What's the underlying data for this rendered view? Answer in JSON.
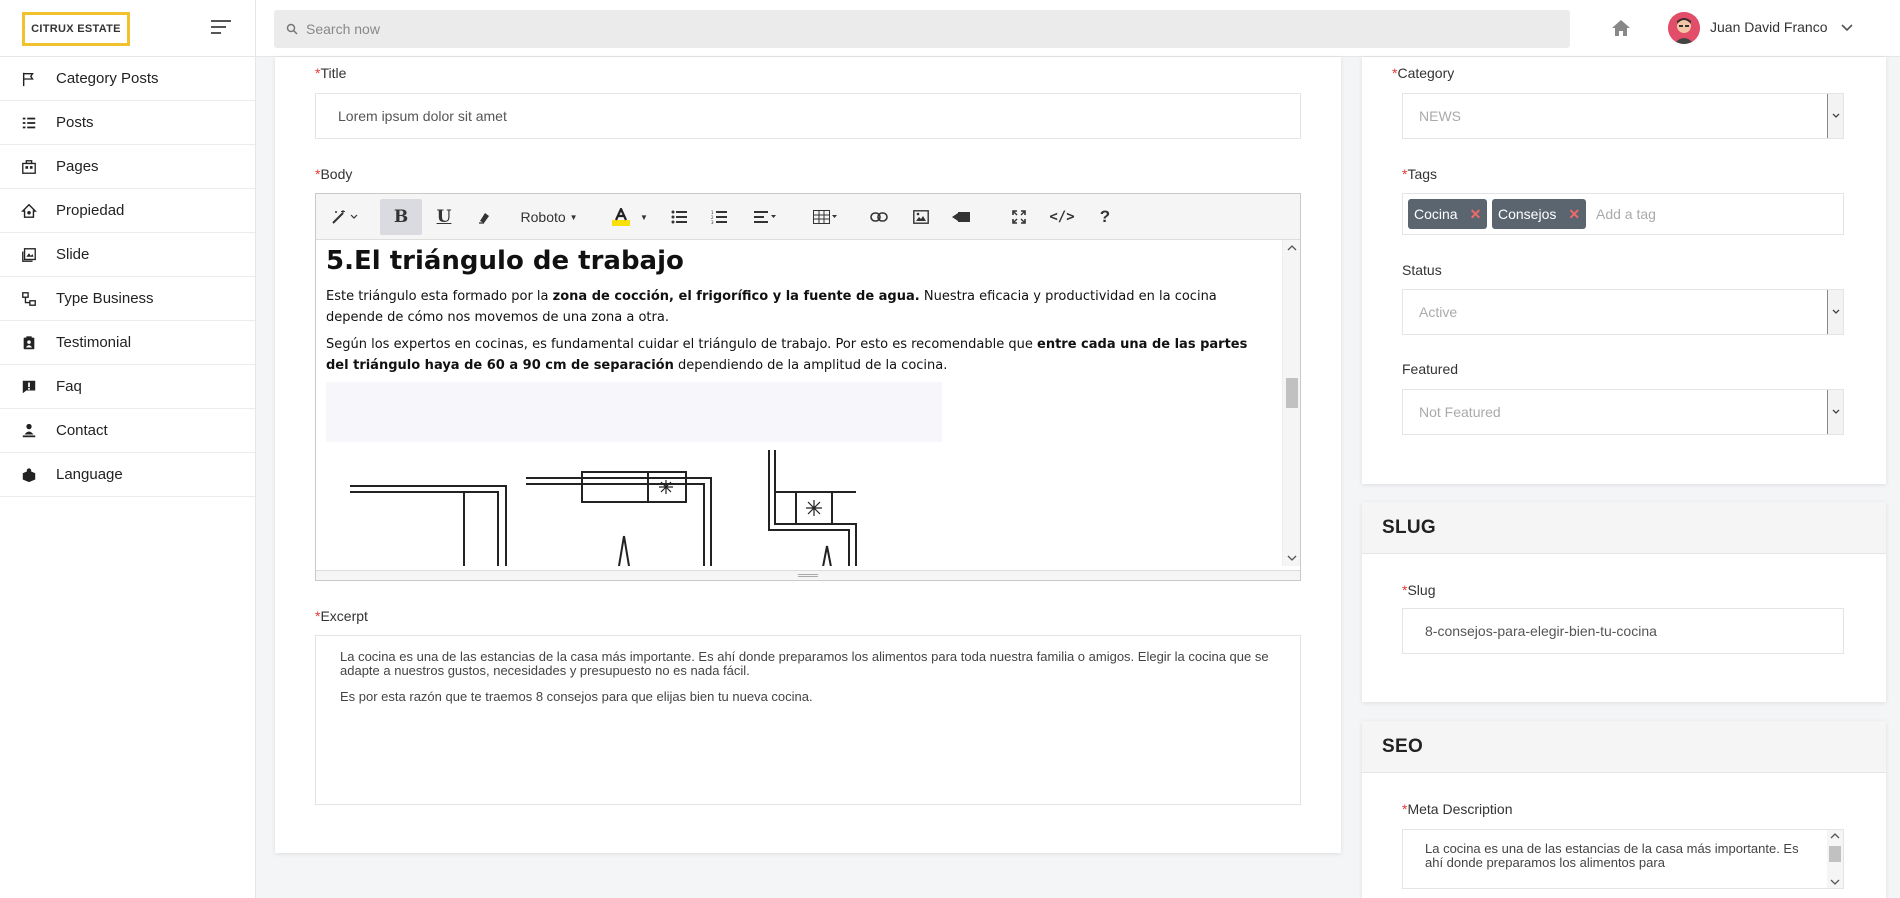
{
  "header": {
    "logo_text": "CITRUX ESTATE",
    "search_placeholder": "Search now",
    "user_name": "Juan David Franco"
  },
  "sidebar": {
    "items": [
      {
        "label": "Category Posts",
        "icon": "flag-icon"
      },
      {
        "label": "Posts",
        "icon": "list-icon"
      },
      {
        "label": "Pages",
        "icon": "pages-icon"
      },
      {
        "label": "Propiedad",
        "icon": "house-icon"
      },
      {
        "label": "Slide",
        "icon": "slide-icon"
      },
      {
        "label": "Type Business",
        "icon": "business-icon"
      },
      {
        "label": "Testimonial",
        "icon": "testimonial-icon"
      },
      {
        "label": "Faq",
        "icon": "faq-icon"
      },
      {
        "label": "Contact",
        "icon": "contact-icon"
      },
      {
        "label": "Language",
        "icon": "language-icon"
      }
    ]
  },
  "form": {
    "title_label": "Title",
    "title_value": "Lorem ipsum dolor sit amet",
    "body_label": "Body",
    "excerpt_label": "Excerpt",
    "excerpt_p1": "La cocina es una de las estancias de la casa más importante.  Es ahí donde preparamos los alimentos para toda nuestra familia o amigos. Elegir la cocina que se adapte a nuestros gustos, necesidades y presupuesto no es nada fácil.",
    "excerpt_p2": "Es por esta razón que te traemos 8 consejos para que elijas bien tu nueva cocina."
  },
  "editor": {
    "font_name": "Roboto",
    "heading": "5.El triángulo de trabajo",
    "p1_a": "Este triángulo esta formado por la ",
    "p1_b": "zona de cocción, el frigorífico y la fuente de agua.",
    "p1_c": " Nuestra eficacia y productividad en la cocina depende de cómo nos movemos de una zona a otra.",
    "p2_a": "Según los expertos en cocinas, es fundamental cuidar el triángulo de trabajo. Por esto es recomendable que ",
    "p2_b": "entre cada una de las partes del triángulo haya de 60 a 90 cm de separación",
    "p2_c": " dependiendo de la amplitud de la cocina."
  },
  "right": {
    "category_label": "Category",
    "category_value": "NEWS",
    "tags_label": "Tags",
    "tags": [
      "Cocina",
      "Consejos"
    ],
    "tags_placeholder": "Add a tag",
    "status_label": "Status",
    "status_value": "Active",
    "featured_label": "Featured",
    "featured_value": "Not Featured",
    "slug_title": "SLUG",
    "slug_label": "Slug",
    "slug_value": "8-consejos-para-elegir-bien-tu-cocina",
    "seo_title": "SEO",
    "meta_label": "Meta Description",
    "meta_value": "La cocina es una de las estancias de la casa más importante.  Es ahí donde preparamos los alimentos para"
  },
  "colors": {
    "accent_logo": "#f2c12e",
    "required": "#e53935",
    "tag_bg": "#5a6570"
  }
}
